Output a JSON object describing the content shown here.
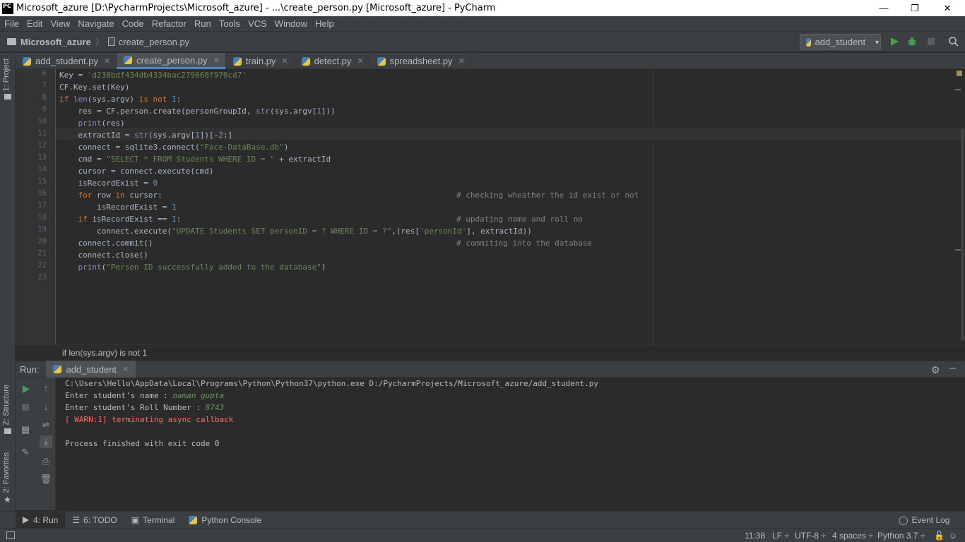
{
  "window": {
    "logo": "PC",
    "title": "Microsoft_azure [D:\\PycharmProjects\\Microsoft_azure] - ...\\create_person.py [Microsoft_azure] - PyCharm",
    "minimize": "—",
    "restore": "❐",
    "close": "✕"
  },
  "menu": [
    "File",
    "Edit",
    "View",
    "Navigate",
    "Code",
    "Refactor",
    "Run",
    "Tools",
    "VCS",
    "Window",
    "Help"
  ],
  "breadcrumbs": {
    "project": "Microsoft_azure",
    "file": "create_person.py"
  },
  "run_config": {
    "label": "add_student",
    "arrow": "▼"
  },
  "side_tabs": {
    "project": "1: Project",
    "structure": "Z: Structure",
    "favorites": "2: Favorites"
  },
  "tabs": [
    {
      "label": "add_student.py"
    },
    {
      "label": "create_person.py"
    },
    {
      "label": "train.py"
    },
    {
      "label": "detect.py"
    },
    {
      "label": "spreadsheet.py"
    }
  ],
  "tab_close": "✕",
  "line_numbers": [
    "6",
    "7",
    "8",
    "9",
    "10",
    "11",
    "12",
    "13",
    "14",
    "15",
    "16",
    "17",
    "18",
    "19",
    "20",
    "21",
    "22",
    "23"
  ],
  "code": {
    "l6a": "Key = ",
    "l6b": "'d238bdf434db4334bac279668f970cd7'",
    "l7": "CF.Key.set(Key)",
    "l8a": "if ",
    "l8b": "len",
    "l8c": "(sys.argv) ",
    "l8d": "is not ",
    "l8e": "1",
    "l8f": ":",
    "l9a": "    res = CF.person.create(personGroupId, ",
    "l9b": "str",
    "l9c": "(sys.argv[",
    "l9d": "1",
    "l9e": "]))",
    "l10a": "    ",
    "l10b": "print",
    "l10c": "(res)",
    "l11a": "    extractId = ",
    "l11b": "str",
    "l11c": "(sys.argv[",
    "l11d": "1",
    "l11e": "])[-",
    "l11f": "2",
    "l11g": ":]",
    "l12a": "    connect = sqlite3.connect(",
    "l12b": "\"Face-DataBase.db\"",
    "l12c": ")",
    "l13a": "    cmd = ",
    "l13b": "\"SELECT * FROM Students WHERE ID = \"",
    "l13c": " + extractId",
    "l14": "    cursor = connect.execute(cmd)",
    "l15a": "    isRecordExist = ",
    "l15b": "0",
    "l16a": "    ",
    "l16b": "for ",
    "l16c": "row ",
    "l16d": "in ",
    "l16e": "cursor:",
    "l16f": "# checking wheather the id exist or not",
    "l17a": "        isRecordExist = ",
    "l17b": "1",
    "l18a": "    ",
    "l18b": "if ",
    "l18c": "isRecordExist == ",
    "l18d": "1",
    "l18e": ":",
    "l18f": "# updating name and roll no",
    "l19a": "        connect.execute(",
    "l19b": "\"UPDATE Students SET personID = ? WHERE ID = ?\"",
    "l19c": ",(res[",
    "l19d": "'personId'",
    "l19e": "], extractId))",
    "l20a": "    connect.commit()",
    "l20b": "# commiting into the database",
    "l21": "    connect.close()",
    "l22a": "    ",
    "l22b": "print",
    "l22c": "(",
    "l22d": "\"Person ID successfully added to the database\"",
    "l22e": ")"
  },
  "editor_breadcrumb": "if len(sys.argv) is not 1",
  "run_panel": {
    "label": "Run:",
    "tab": "add_student",
    "lines": {
      "cmd": "C:\\Users\\Hello\\AppData\\Local\\Programs\\Python\\Python37\\python.exe D:/PycharmProjects/Microsoft_azure/add_student.py",
      "name_prompt": "Enter student's name : ",
      "name_value": "naman gupta",
      "roll_prompt": "Enter student's Roll Number : ",
      "roll_value": "8743",
      "warn": "[ WARN:1] terminating async callback",
      "exit": "Process finished with exit code 0"
    }
  },
  "tool_windows": [
    {
      "label": "4: Run"
    },
    {
      "label": "6: TODO"
    },
    {
      "label": "Terminal"
    },
    {
      "label": "Python Console"
    }
  ],
  "event_log": "Event Log",
  "status": {
    "position": "11:38",
    "line_sep": "LF ÷",
    "encoding": "UTF-8 ÷",
    "indent": "4 spaces ÷",
    "interpreter": "Python 3.7 ÷"
  },
  "colors": {
    "accent": "#4a88c7",
    "keyword": "#cc7832",
    "string": "#6a8759",
    "number": "#6897bb",
    "comment": "#808080",
    "warn": "#ff6b68",
    "input": "#629755"
  }
}
